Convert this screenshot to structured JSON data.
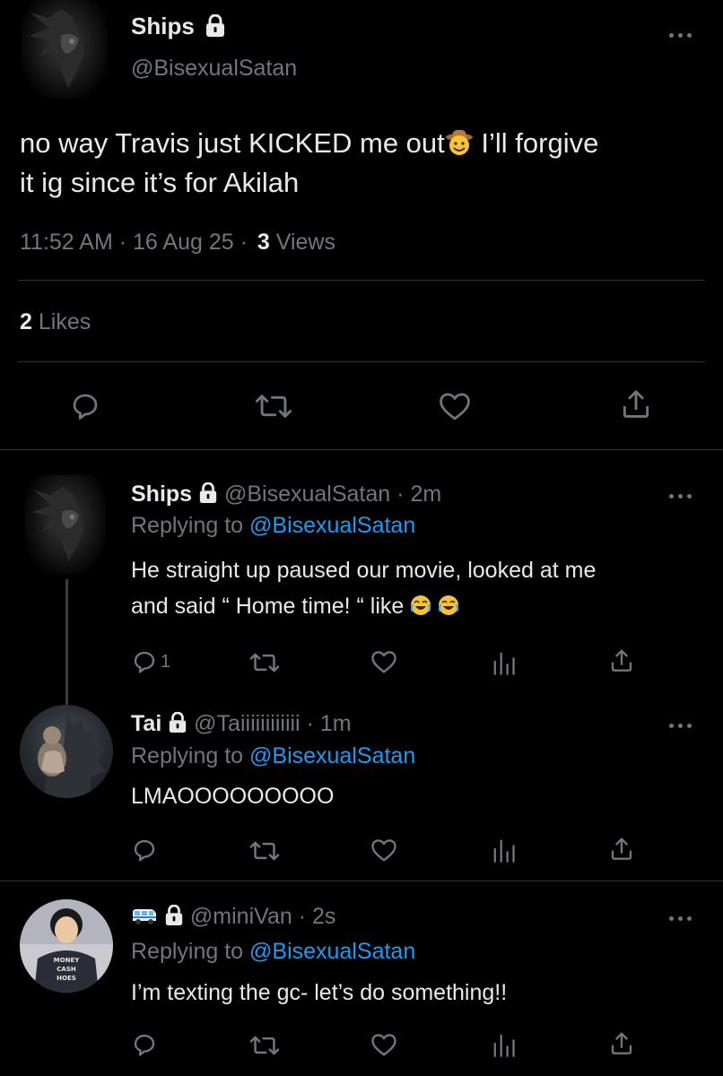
{
  "main_tweet": {
    "display_name": "Ships",
    "handle": "@BisexualSatan",
    "text_line1": "no way Travis just KICKED me out",
    "text_line1_after": " I’ll forgive",
    "text_line2": "it ig since it’s for Akilah",
    "time": "11:52 AM",
    "date": "16 Aug 25",
    "views_count": "3",
    "views_label": "Views",
    "likes_count": "2",
    "likes_label": "Likes"
  },
  "replies": [
    {
      "display_name": "Ships",
      "handle": "@BisexualSatan",
      "time": "2m",
      "replying_prefix": "Replying to",
      "replying_to": "@BisexualSatan",
      "text_line1": "He straight up paused our movie, looked at me",
      "text_line2": "and said “ Home time! “ like",
      "reply_count": "1"
    },
    {
      "display_name": "Tai",
      "handle": "@Taiiiiiiiiiiii",
      "time": "1m",
      "replying_prefix": "Replying to",
      "replying_to": "@BisexualSatan",
      "text_line1": "LMAOOOOOOOOO",
      "reply_count": ""
    },
    {
      "display_name": "",
      "handle": "@miniVan",
      "time": "2s",
      "replying_prefix": "Replying to",
      "replying_to": "@BisexualSatan",
      "text_line1": "I’m texting the gc- let’s do something!!",
      "reply_count": "",
      "avatar_shirt_text": [
        "MONEY",
        "CASH",
        "HOES"
      ]
    }
  ],
  "separator": "·",
  "colors": {
    "background": "#000000",
    "text": "#e7e9ea",
    "muted": "#71767b",
    "link": "#1d9bf0",
    "divider": "#2f3336"
  }
}
